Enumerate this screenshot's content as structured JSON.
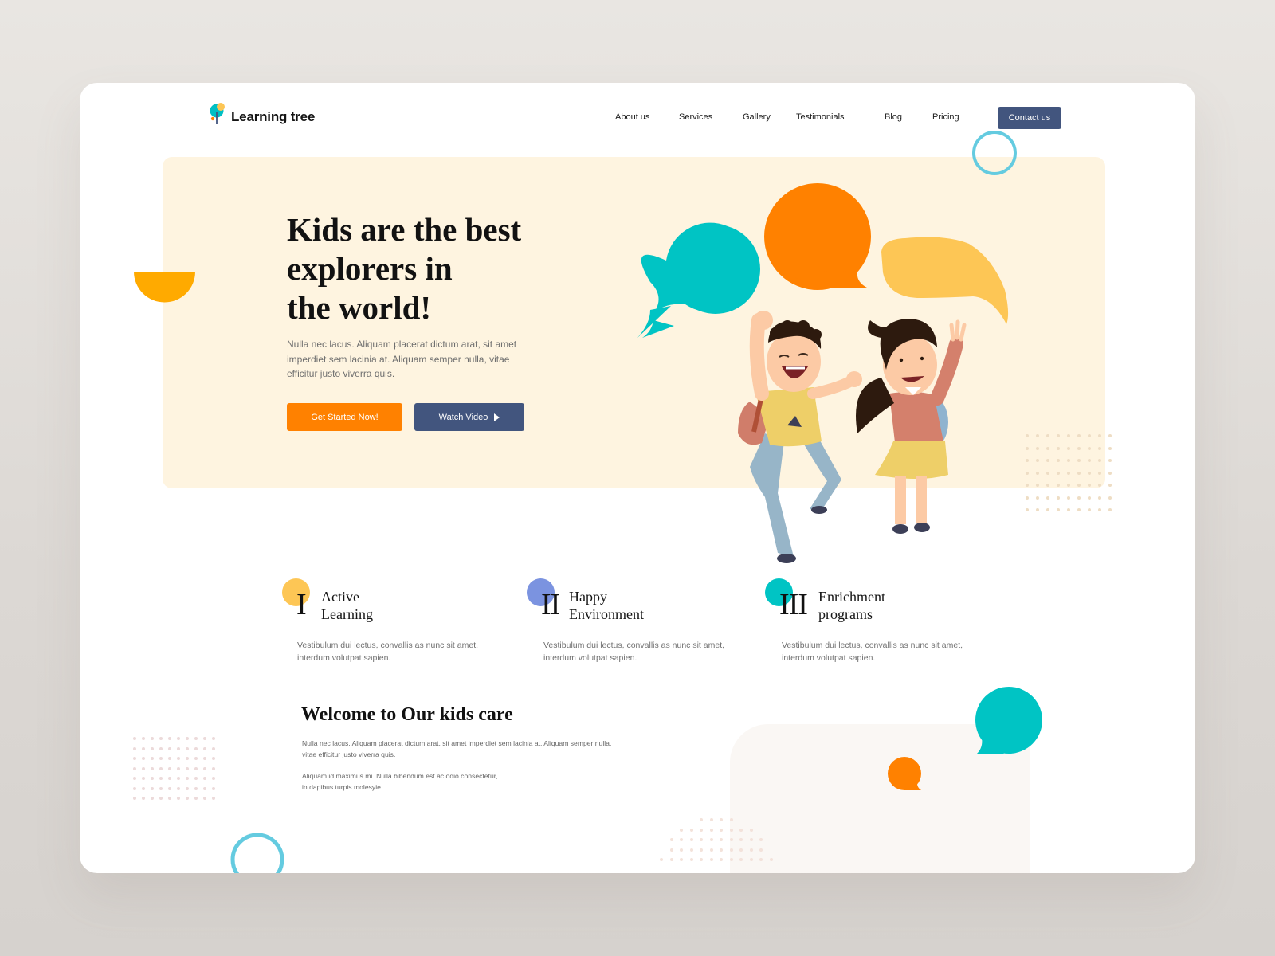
{
  "brand": {
    "name": "Learning tree"
  },
  "nav": {
    "items": [
      {
        "label": "About us"
      },
      {
        "label": "Services"
      },
      {
        "label": "Gallery"
      },
      {
        "label": "Testimonials"
      },
      {
        "label": "Blog"
      },
      {
        "label": "Pricing"
      }
    ],
    "contact_label": "Contact us"
  },
  "hero": {
    "title_lines": [
      "Kids are the best",
      "explorers in",
      "the world!"
    ],
    "description": "Nulla nec lacus. Aliquam placerat dictum arat, sit amet imperdiet sem lacinia at. Aliquam semper nulla, vitae efficitur justo viverra quis.",
    "primary_button": "Get Started Now!",
    "secondary_button": "Watch Video",
    "secondary_button_icon": "play-icon"
  },
  "features": [
    {
      "numeral": "I",
      "title_lines": [
        "Active",
        "Learning"
      ],
      "description": "Vestibulum dui lectus, convallis as nunc sit amet, interdum volutpat sapien.",
      "accent": "#fdc655"
    },
    {
      "numeral": "II",
      "title_lines": [
        "Happy",
        "Environment"
      ],
      "description": "Vestibulum dui lectus, convallis as nunc sit amet, interdum volutpat sapien.",
      "accent": "#7b93e0"
    },
    {
      "numeral": "III",
      "title_lines": [
        "Enrichment",
        "programs"
      ],
      "description": "Vestibulum dui lectus, convallis as nunc sit amet, interdum volutpat sapien.",
      "accent": "#00c4c4"
    }
  ],
  "welcome": {
    "title": "Welcome to Our kids care",
    "paragraph1_lines": [
      "Nulla nec lacus. Aliquam placerat dictum arat, sit amet imperdiet sem lacinia at. Aliquam semper nulla,",
      "vitae efficitur justo viverra quis."
    ],
    "paragraph2_lines": [
      "Aliquam id maximus mi. Nulla bibendum est ac odio consectetur,",
      "in dapibus turpis molesyie."
    ]
  },
  "colors": {
    "primary_orange": "#ff8100",
    "navy": "#42557e",
    "teal": "#00c4c4",
    "yellow": "#fdc655",
    "hero_bg": "#fef4e0",
    "ring_blue": "#64cbe0",
    "half_circle": "#ffaa00"
  }
}
